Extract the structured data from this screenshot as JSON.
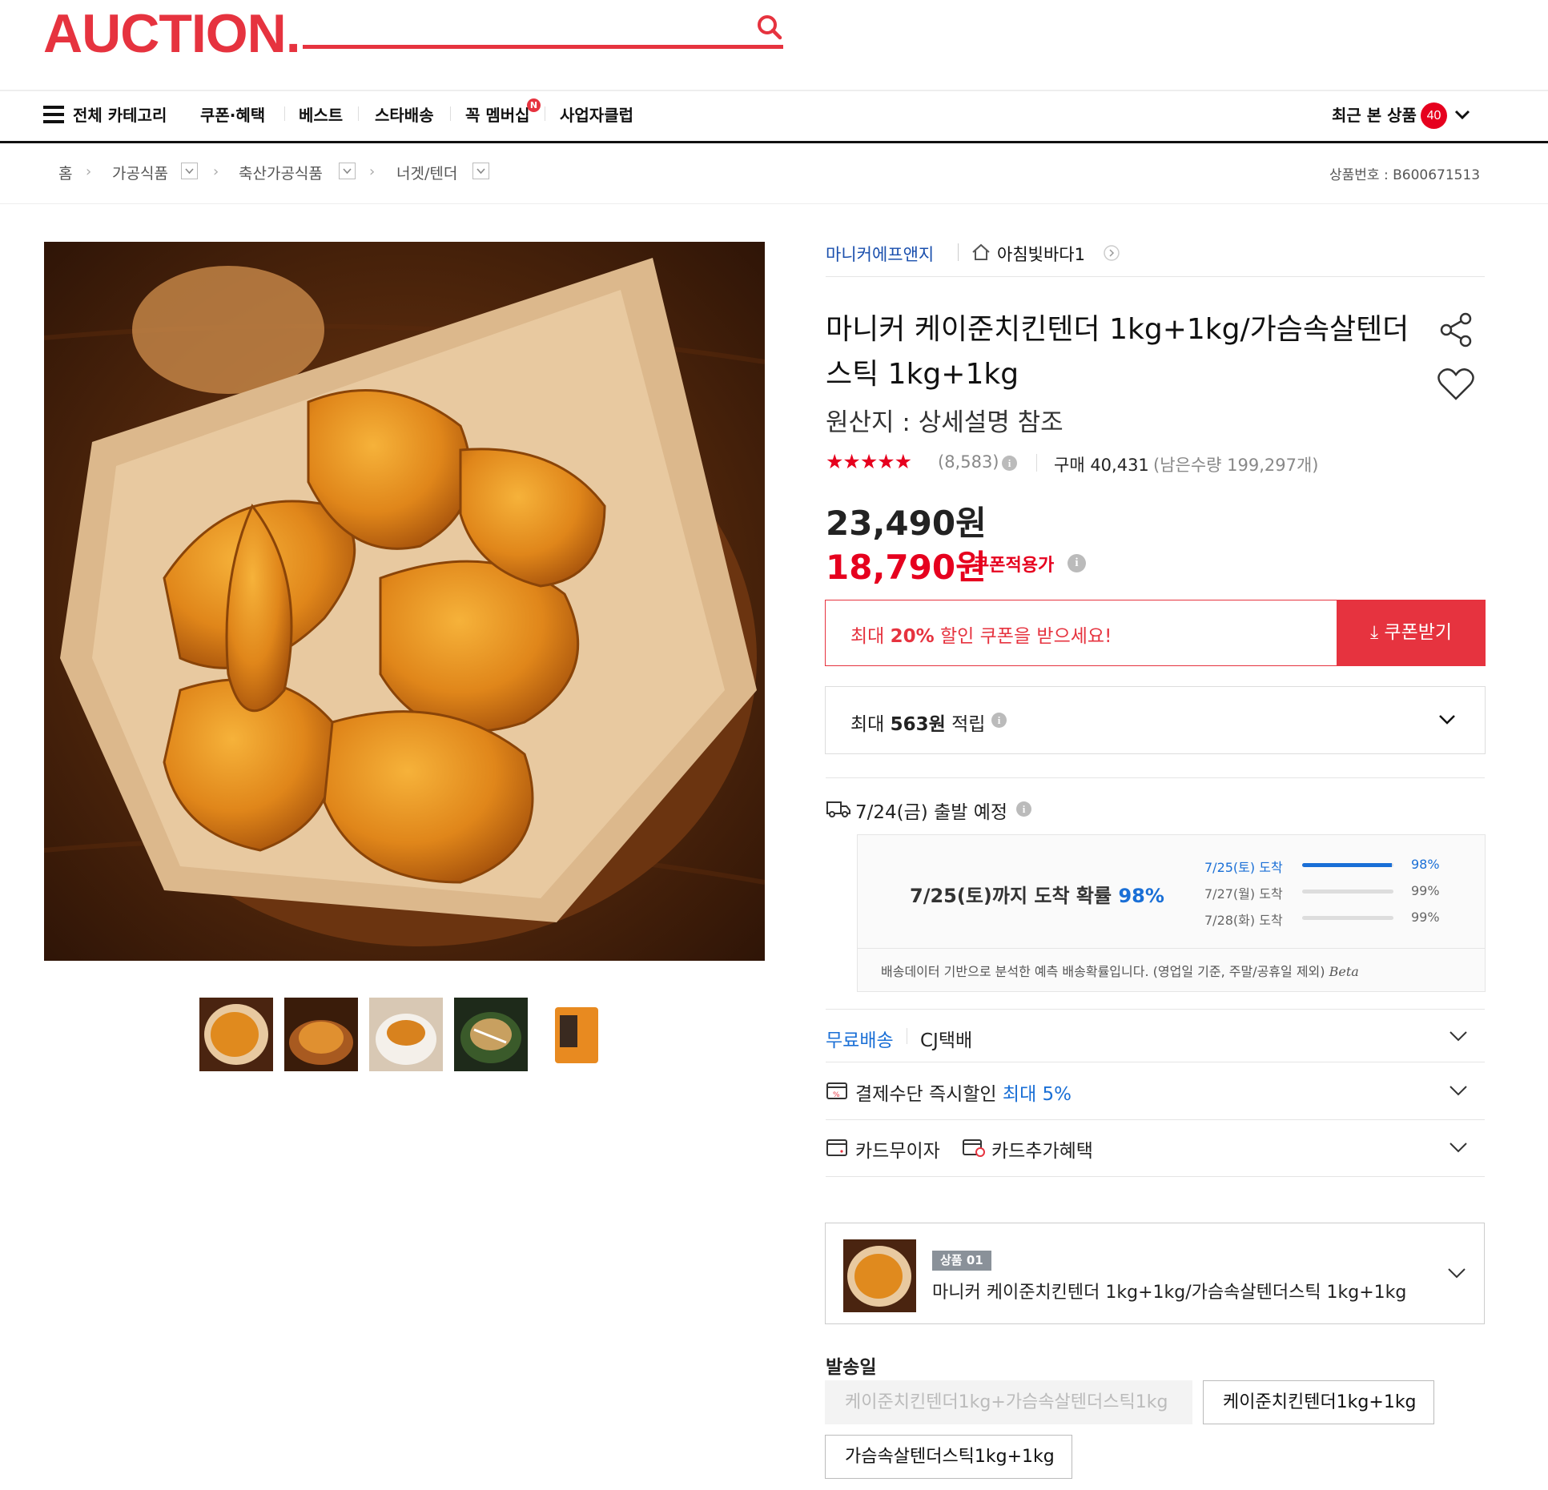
{
  "header": {
    "logo": "AUCTION.",
    "search_icon": "search-icon",
    "nav": {
      "all_categories": "전체 카테고리",
      "coupon": "쿠폰·혜택",
      "best": "베스트",
      "star_delivery": "스타배송",
      "membership": "꼭 멤버십",
      "membership_badge": "N",
      "business_club": "사업자클럽",
      "recent_label": "최근 본 상품",
      "recent_count": "40"
    }
  },
  "breadcrumb": {
    "home": "홈",
    "items": [
      "가공식품",
      "축산가공식품",
      "너겟/텐더"
    ],
    "product_no": "상품번호 : B600671513"
  },
  "product": {
    "seller": "마니커에프앤지",
    "store": "아침빛바다1",
    "title": "마니커 케이준치킨텐더 1kg+1kg/가슴속살텐더스틱 1kg+1kg",
    "origin": "원산지 : 상세설명 참조",
    "rating": 4.9,
    "review_count": "(8,583)",
    "purchase_label": "구매 40,431",
    "remaining": "(남은수량 199,297개)",
    "original_price": "23,490원",
    "coupon_price": "18,790원",
    "coupon_price_label": "쿠폰적용가",
    "coupon_banner": {
      "prefix": "최대 ",
      "strong": "20%",
      "suffix": " 할인 쿠폰을 받으세요!"
    },
    "coupon_button": "쿠폰받기",
    "points": {
      "prefix": "최대 ",
      "strong": "563원",
      "suffix": " 적립"
    }
  },
  "delivery": {
    "ship_date": "7/24(금) 출발 예정",
    "prob_prefix": "7/25(토)까지 도착 확률 ",
    "prob_value": "98%",
    "rows": [
      {
        "label": "7/25(토) 도착",
        "pct": "98%",
        "value": 0.98,
        "highlight": true
      },
      {
        "label": "7/27(월) 도착",
        "pct": "99%",
        "value": 0.99,
        "highlight": false
      },
      {
        "label": "7/28(화) 도착",
        "pct": "99%",
        "value": 0.99,
        "highlight": false
      }
    ],
    "note": "배송데이터 기반으로 분석한 예측 배송확률입니다. (영업일 기준, 주말/공휴일 제외)",
    "beta": "Beta"
  },
  "options": {
    "free_shipping": "무료배송",
    "courier": "CJ택배",
    "payment_discount": "결제수단 즉시할인",
    "payment_discount_value": "최대 5%",
    "card_interest_free": "카드무이자",
    "card_benefit": "카드추가혜택"
  },
  "selected": {
    "tag": "상품 01",
    "name": "마니커 케이준치킨텐더 1kg+1kg/가슴속살텐더스틱 1kg+1kg"
  },
  "ship_day": {
    "label": "발송일",
    "options": [
      "케이준치킨텐더1kg+가슴속살텐더스틱1kg",
      "케이준치킨텐더1kg+1kg",
      "가슴속살텐더스틱1kg+1kg"
    ]
  },
  "colors": {
    "brand_red": "#e6333f",
    "price_red": "#e6001e",
    "link_blue": "#1a4fad",
    "bar_blue": "#1a6fd6"
  }
}
